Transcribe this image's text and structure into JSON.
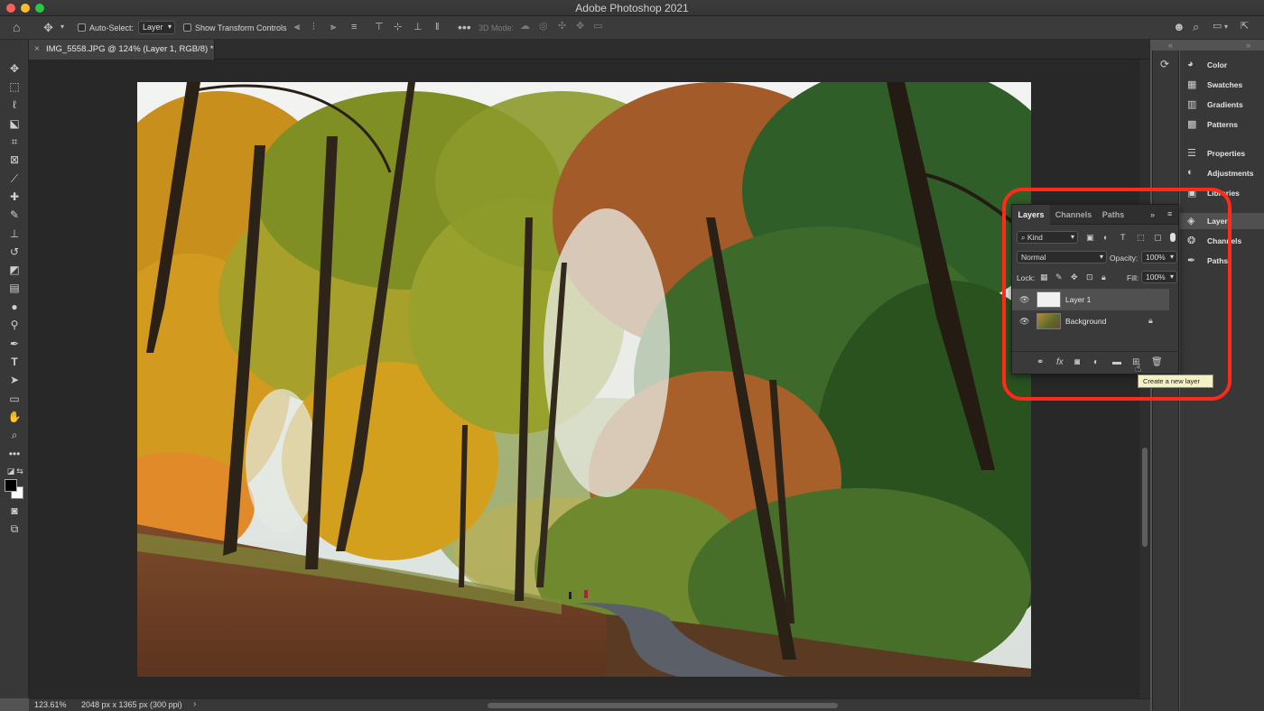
{
  "app": {
    "title": "Adobe Photoshop 2021"
  },
  "options_bar": {
    "auto_select_label": "Auto-Select:",
    "auto_select_value": "Layer",
    "show_transform_label": "Show Transform Controls",
    "mode_3d_label": "3D Mode:"
  },
  "document": {
    "tab_label": "IMG_5558.JPG @ 124% (Layer 1, RGB/8) *"
  },
  "status": {
    "zoom": "123.61%",
    "info": "2048 px x 1365 px (300 ppi)"
  },
  "right_panel": {
    "items": [
      {
        "label": "Color",
        "icon": "color-wheel-icon"
      },
      {
        "label": "Swatches",
        "icon": "swatches-grid-icon"
      },
      {
        "label": "Gradients",
        "icon": "gradient-icon"
      },
      {
        "label": "Patterns",
        "icon": "patterns-grid-icon"
      },
      {
        "label": "Properties",
        "icon": "sliders-icon"
      },
      {
        "label": "Adjustments",
        "icon": "adjustments-circle-icon"
      },
      {
        "label": "Libraries",
        "icon": "libraries-icon"
      },
      {
        "label": "Layers",
        "icon": "layers-stack-icon"
      },
      {
        "label": "Channels",
        "icon": "channels-circles-icon"
      },
      {
        "label": "Paths",
        "icon": "pen-path-icon"
      }
    ]
  },
  "layers_panel": {
    "tabs": [
      "Layers",
      "Channels",
      "Paths"
    ],
    "active_tab": "Layers",
    "filter_kind": "Kind",
    "blend_mode": "Normal",
    "opacity_label": "Opacity:",
    "opacity_value": "100%",
    "lock_label": "Lock:",
    "fill_label": "Fill:",
    "fill_value": "100%",
    "layers": [
      {
        "name": "Layer 1",
        "selected": true,
        "locked": false
      },
      {
        "name": "Background",
        "selected": false,
        "locked": true
      }
    ],
    "tooltip": "Create a new layer"
  },
  "colors": {
    "highlight": "#ff2a1a",
    "selected_layer": "#505050",
    "tooltip_bg": "#f4f1c6"
  }
}
